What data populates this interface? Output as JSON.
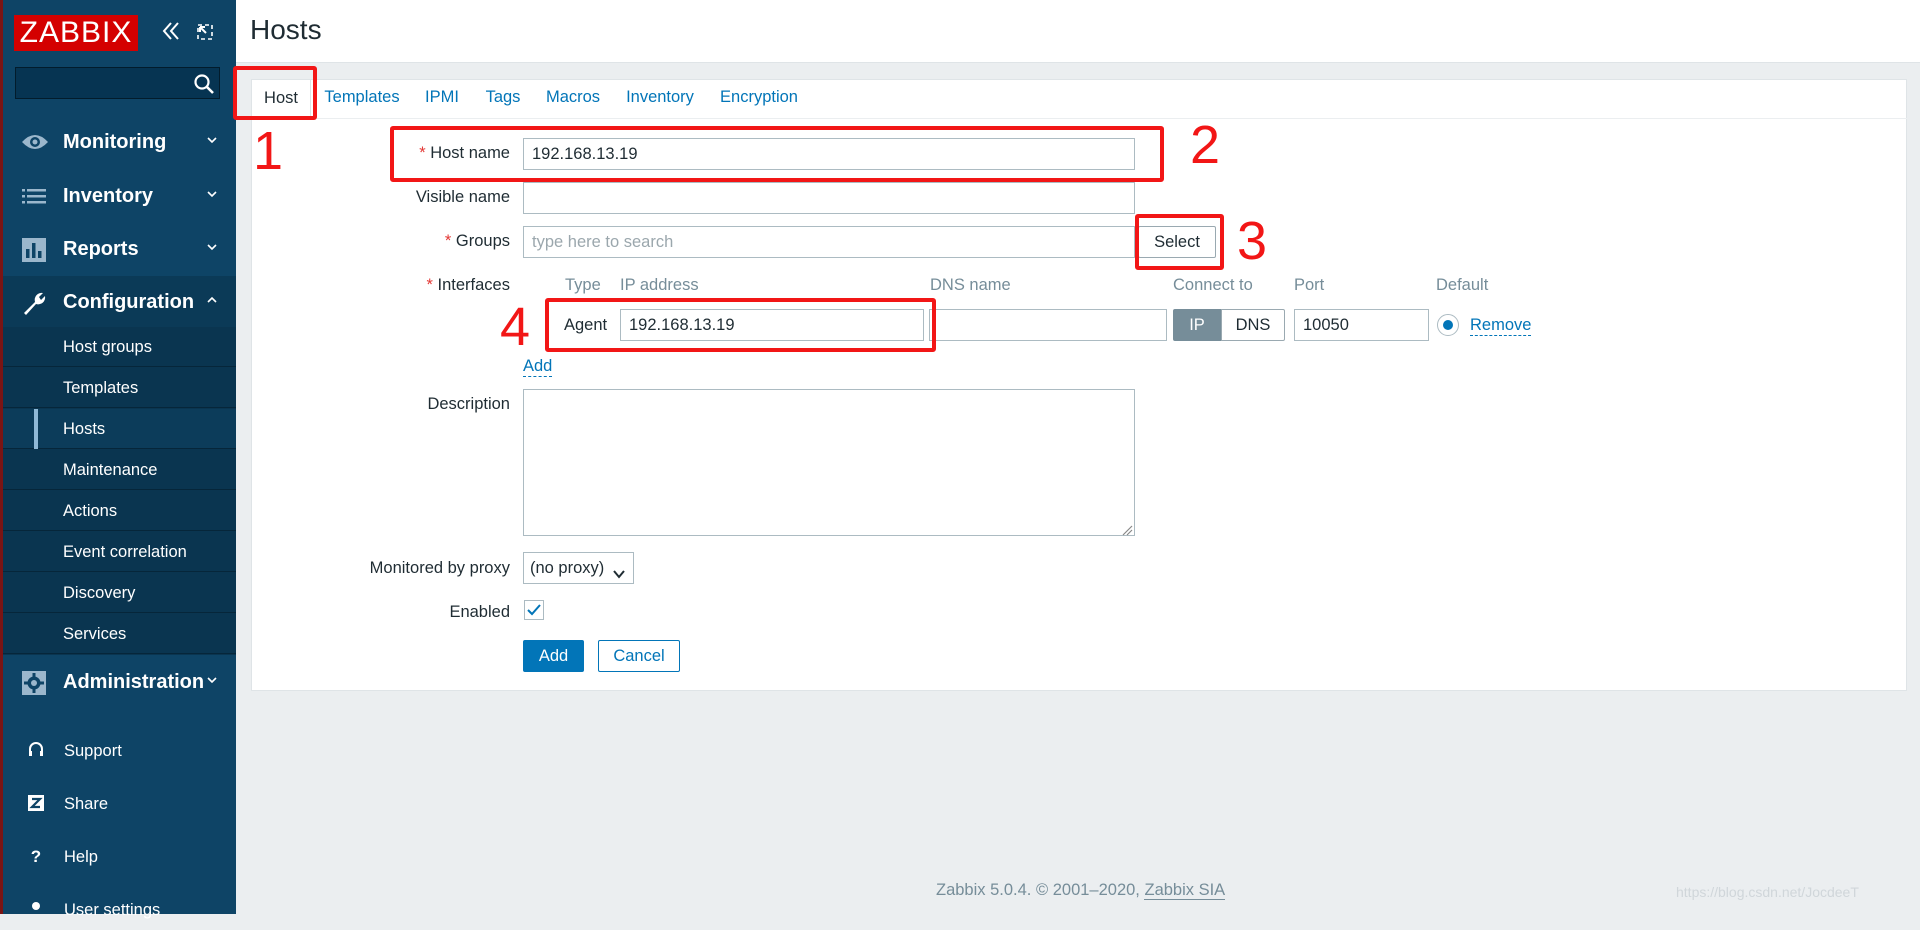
{
  "sidebar": {
    "logo": "ZABBIX",
    "collapse_icon": "double-chevron-left-icon",
    "kiosk_icon": "kiosk-mode-icon",
    "search_placeholder": "",
    "menu": [
      {
        "label": "Monitoring",
        "icon": "eye-icon"
      },
      {
        "label": "Inventory",
        "icon": "list-icon"
      },
      {
        "label": "Reports",
        "icon": "bar-chart-icon"
      },
      {
        "label": "Configuration",
        "icon": "wrench-icon"
      },
      {
        "label": "Administration",
        "icon": "gear-icon"
      }
    ],
    "submenu": [
      "Host groups",
      "Templates",
      "Hosts",
      "Maintenance",
      "Actions",
      "Event correlation",
      "Discovery",
      "Services"
    ],
    "active_submenu": "Hosts",
    "footer": [
      {
        "label": "Support",
        "icon": "headset-icon"
      },
      {
        "label": "Share",
        "icon": "share-z-icon"
      },
      {
        "label": "Help",
        "icon": "question-icon"
      },
      {
        "label": "User settings",
        "icon": "user-icon"
      }
    ]
  },
  "header": {
    "title": "Hosts"
  },
  "tabs": [
    "Host",
    "Templates",
    "IPMI",
    "Tags",
    "Macros",
    "Inventory",
    "Encryption"
  ],
  "active_tab": "Host",
  "form": {
    "host_name_label": "Host name",
    "host_name_value": "192.168.13.19",
    "visible_name_label": "Visible name",
    "visible_name_value": "",
    "groups_label": "Groups",
    "groups_placeholder": "type here to search",
    "select_button": "Select",
    "interfaces_label": "Interfaces",
    "interface_columns": {
      "type": "Type",
      "ip": "IP address",
      "dns": "DNS name",
      "connect": "Connect to",
      "port": "Port",
      "default": "Default"
    },
    "interface": {
      "type": "Agent",
      "ip": "192.168.13.19",
      "dns": "",
      "connect_ip": "IP",
      "connect_dns": "DNS",
      "connect_selected": "IP",
      "port": "10050",
      "remove": "Remove"
    },
    "add_interface_link": "Add",
    "description_label": "Description",
    "description_value": "",
    "proxy_label": "Monitored by proxy",
    "proxy_value": "(no proxy)",
    "enabled_label": "Enabled",
    "enabled_checked": true,
    "add_button": "Add",
    "cancel_button": "Cancel"
  },
  "annotations": [
    "1",
    "2",
    "3",
    "4"
  ],
  "footer": {
    "copyright": "Zabbix 5.0.4. © 2001–2020,",
    "company_link": "Zabbix SIA",
    "watermark": "https://blog.csdn.net/JocdeeT"
  },
  "colors": {
    "sidebar_bg": "#0e4466",
    "logo_bg": "#d40000",
    "link": "#0275b8",
    "primary_button": "#0275b8",
    "annotation_red": "#f21616"
  }
}
